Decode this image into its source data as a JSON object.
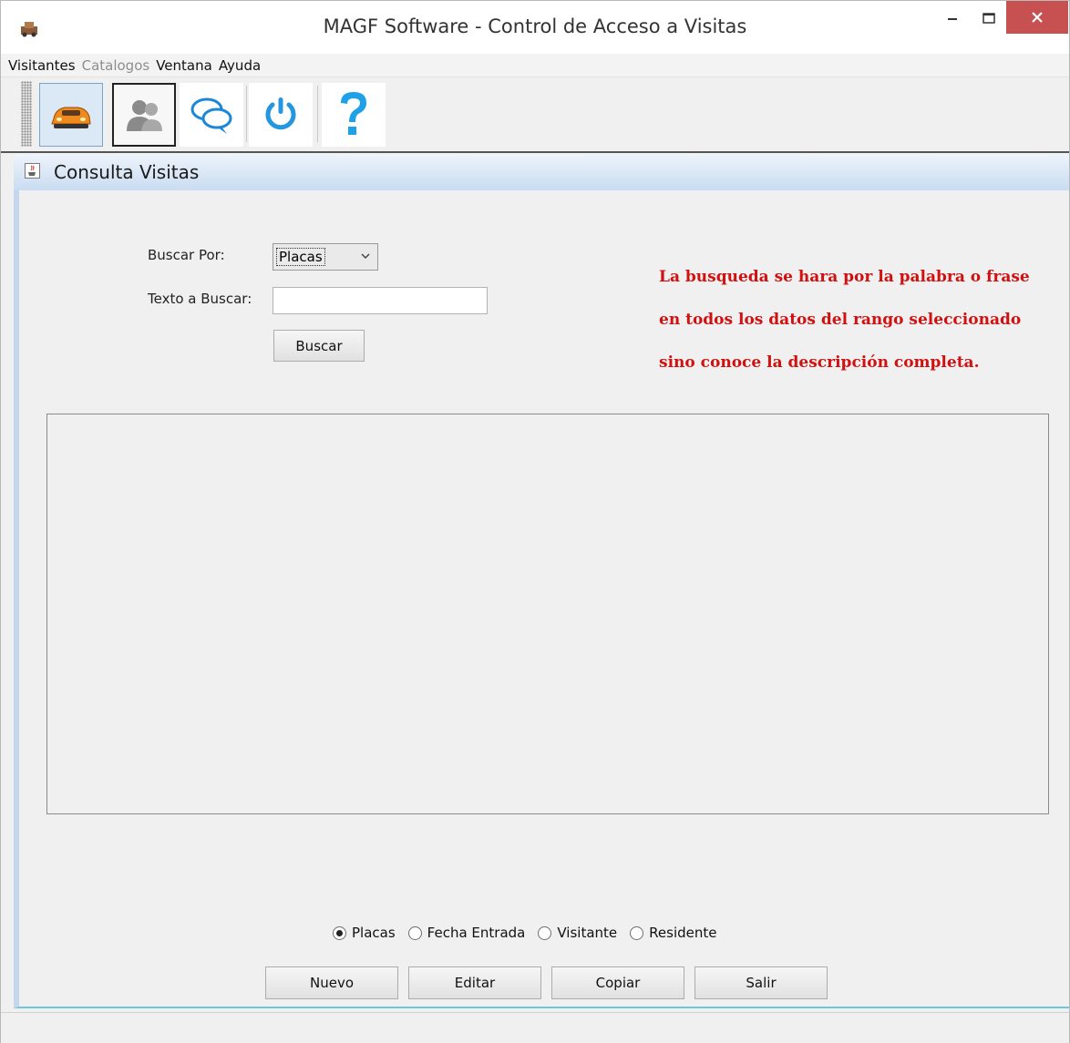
{
  "window": {
    "title": "MAGF Software - Control de Acceso a Visitas",
    "controls": {
      "minimize_icon": "minimize-icon",
      "maximize_icon": "maximize-icon",
      "close_icon": "close-icon"
    }
  },
  "menu": [
    {
      "label": "Visitantes",
      "enabled": true
    },
    {
      "label": "Catalogos",
      "enabled": false
    },
    {
      "label": "Ventana",
      "enabled": true
    },
    {
      "label": "Ayuda",
      "enabled": true
    }
  ],
  "toolbar": {
    "buttons": [
      {
        "icon": "car-icon",
        "state": "selected"
      },
      {
        "icon": "users-icon",
        "state": "pressed"
      },
      {
        "icon": "chat-bubbles-icon",
        "state": "normal"
      },
      {
        "icon": "power-icon",
        "state": "normal"
      },
      {
        "icon": "help-icon",
        "state": "normal"
      }
    ]
  },
  "internal_frame": {
    "title": "Consulta Visitas",
    "search": {
      "buscar_por_label": "Buscar Por:",
      "buscar_por_value": "Placas",
      "texto_label": "Texto a Buscar:",
      "texto_value": "",
      "buscar_button": "Buscar"
    },
    "note": [
      "La busqueda se hara por la palabra o frase",
      "en todos los datos del rango seleccionado",
      "sino conoce la descripción completa."
    ],
    "colors": {
      "note": "#d21010",
      "title_gradient_end": "#c9dcf1"
    },
    "radios": [
      {
        "label": "Placas",
        "checked": true
      },
      {
        "label": "Fecha Entrada",
        "checked": false
      },
      {
        "label": "Visitante",
        "checked": false
      },
      {
        "label": "Residente",
        "checked": false
      }
    ],
    "buttons": {
      "nuevo": "Nuevo",
      "editar": "Editar",
      "copiar": "Copiar",
      "salir": "Salir"
    }
  }
}
